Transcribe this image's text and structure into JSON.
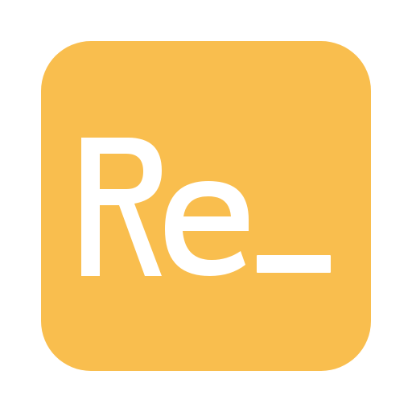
{
  "app_icon": {
    "logo_text": "Re_",
    "background_color": "#f9be4e",
    "foreground_color": "#ffffff",
    "icon": "re-logo-icon"
  }
}
